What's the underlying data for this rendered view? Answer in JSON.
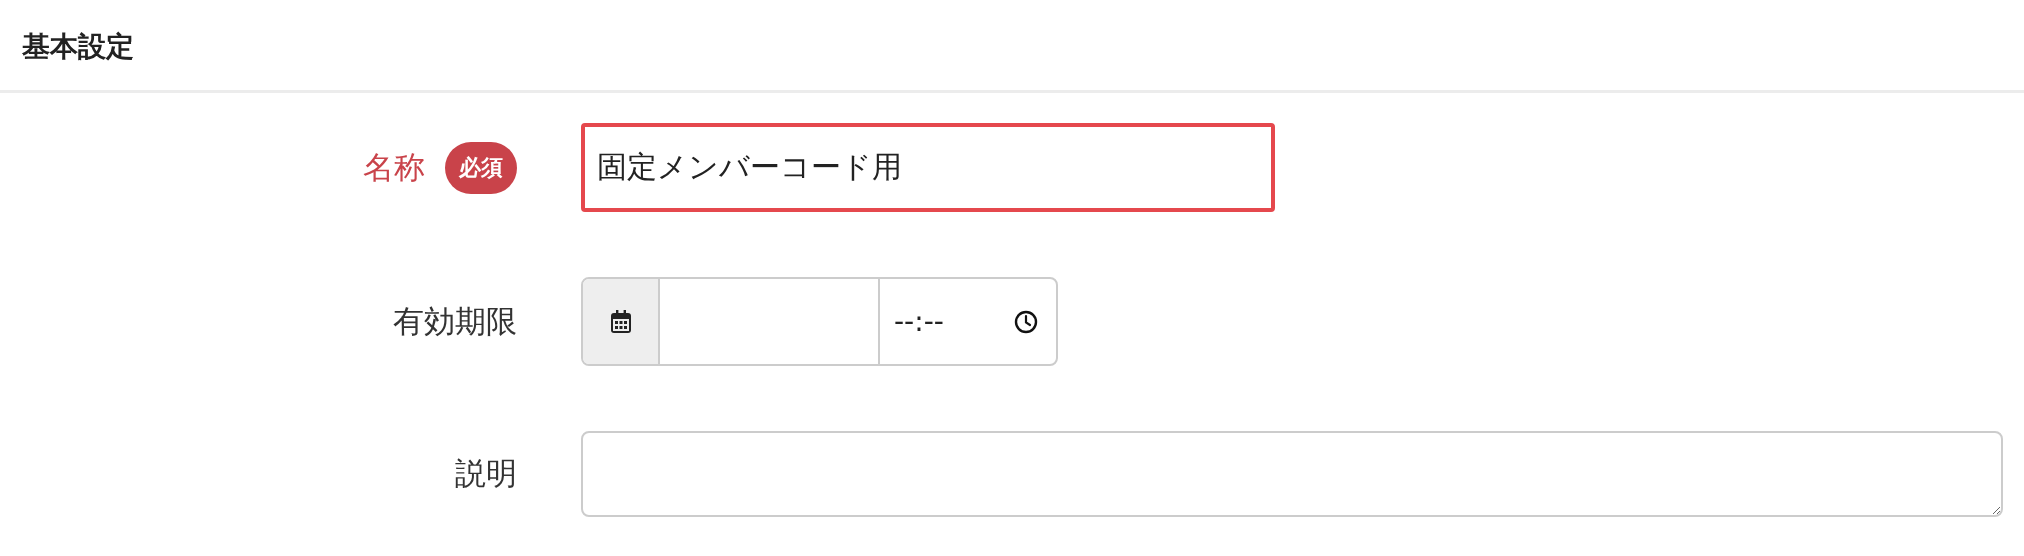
{
  "section": {
    "title": "基本設定"
  },
  "fields": [
    {
      "kind": "text",
      "label": "名称",
      "badge": "必須",
      "value": "固定メンバーコード用",
      "invalid": true
    },
    {
      "kind": "datetime",
      "label": "有効期限",
      "time_placeholder": "--:--",
      "invalid": false
    },
    {
      "kind": "textarea",
      "label": "説明",
      "invalid": false
    }
  ]
}
